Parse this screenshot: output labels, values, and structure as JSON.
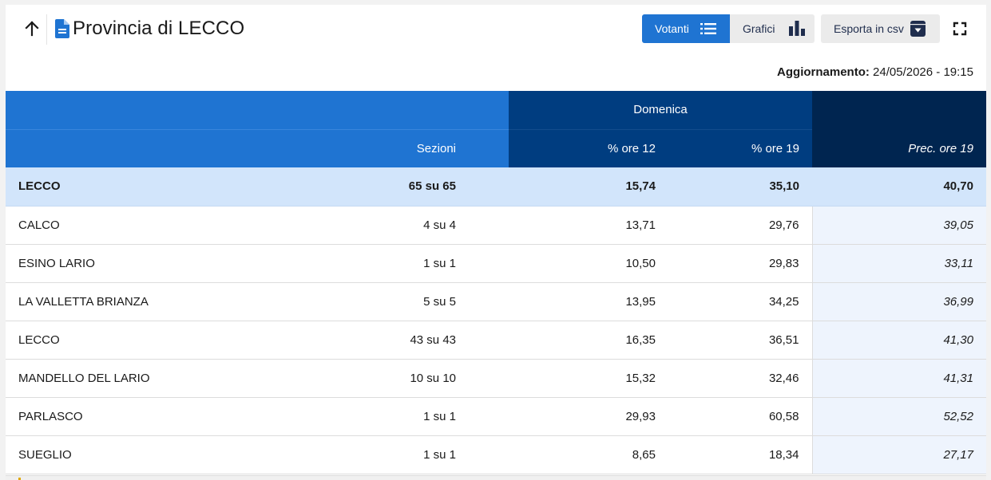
{
  "header": {
    "title": "Provincia di LECCO",
    "buttons": {
      "votanti": "Votanti",
      "grafici": "Grafici",
      "esporta": "Esporta in csv"
    },
    "update_label": "Aggiornamento:",
    "update_value": "24/05/2026 - 19:15"
  },
  "colors": {
    "primary_blue": "#1f74d2",
    "dark_blue": "#003d80",
    "navy": "#002550",
    "total_row_bg": "#d2e5fb",
    "prec_col_bg": "#eef4fd"
  },
  "table": {
    "group_header": "Domenica",
    "columns": {
      "sezioni": "Sezioni",
      "ore12": "% ore 12",
      "ore19": "% ore 19",
      "prec": "Prec. ore 19"
    },
    "total": {
      "name": "LECCO",
      "sezioni": "65 su 65",
      "ore12": "15,74",
      "ore19": "35,10",
      "prec": "40,70"
    },
    "rows": [
      {
        "name": "CALCO",
        "sezioni": "4 su 4",
        "ore12": "13,71",
        "ore19": "29,76",
        "prec": "39,05"
      },
      {
        "name": "ESINO LARIO",
        "sezioni": "1 su 1",
        "ore12": "10,50",
        "ore19": "29,83",
        "prec": "33,11"
      },
      {
        "name": "LA VALLETTA BRIANZA",
        "sezioni": "5 su 5",
        "ore12": "13,95",
        "ore19": "34,25",
        "prec": "36,99"
      },
      {
        "name": "LECCO",
        "sezioni": "43 su 43",
        "ore12": "16,35",
        "ore19": "36,51",
        "prec": "41,30"
      },
      {
        "name": "MANDELLO DEL LARIO",
        "sezioni": "10 su 10",
        "ore12": "15,32",
        "ore19": "32,46",
        "prec": "41,31"
      },
      {
        "name": "PARLASCO",
        "sezioni": "1 su 1",
        "ore12": "29,93",
        "ore19": "60,58",
        "prec": "52,52"
      },
      {
        "name": "SUEGLIO",
        "sezioni": "1 su 1",
        "ore12": "8,65",
        "ore19": "18,34",
        "prec": "27,17"
      }
    ]
  }
}
